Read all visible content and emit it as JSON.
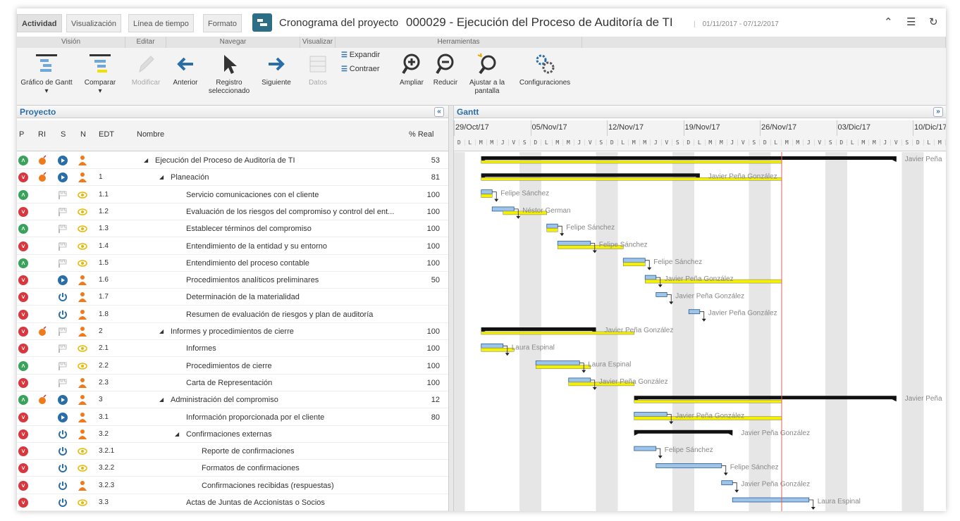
{
  "tabs": [
    "Actividad",
    "Visualización",
    "Línea de tiempo",
    "Formato"
  ],
  "breadcrumb": {
    "parent": "Cronograma del proyecto",
    "separator": "›",
    "current": "000029 - Ejecución del Proceso de Auditoría de TI"
  },
  "date_range": "01/11/2017 - 07/12/2017",
  "ribbon": {
    "groups": [
      "Visión",
      "Editar",
      "Navegar",
      "Visualizar",
      "Herramientas"
    ],
    "buttons": {
      "gantt": "Gráfico de Gantt",
      "compare": "Comparar",
      "modify": "Modificar",
      "previous": "Anterior",
      "selected_1": "Registro",
      "selected_2": "seleccionado",
      "next": "Siguiente",
      "data": "Datos",
      "expand": "Expandir",
      "collapse": "Contraer",
      "zoom_in": "Ampliar",
      "zoom_out": "Reducir",
      "fit_1": "Ajustar a la",
      "fit_2": "pantalla",
      "settings": "Configuraciones"
    }
  },
  "panels": {
    "project": "Proyecto",
    "gantt": "Gantt"
  },
  "columns": {
    "p": "P",
    "ri": "RI",
    "s": "S",
    "n": "N",
    "edt": "EDT",
    "name": "Nombre",
    "pct": "% Real"
  },
  "rows": [
    {
      "p": "green",
      "ri": true,
      "s": "run",
      "n": "user",
      "edt": "",
      "name": "Ejecución del Proceso de Auditoría de TI",
      "level": 0,
      "summary": true,
      "pct": "53"
    },
    {
      "p": "red",
      "ri": true,
      "s": "run",
      "n": "user",
      "edt": "1",
      "name": "Planeación",
      "level": 1,
      "summary": true,
      "pct": "81"
    },
    {
      "p": "green",
      "ri": false,
      "s": "flag",
      "n": "eye",
      "edt": "1.1",
      "name": "Servicio comunicaciones con el cliente",
      "level": 2,
      "summary": false,
      "pct": "100"
    },
    {
      "p": "red",
      "ri": false,
      "s": "flag",
      "n": "eye",
      "edt": "1.2",
      "name": "Evaluación de los riesgos del compromiso y control del ent...",
      "level": 2,
      "summary": false,
      "pct": "100"
    },
    {
      "p": "green",
      "ri": false,
      "s": "flag",
      "n": "eye",
      "edt": "1.3",
      "name": "Establecer términos del compromiso",
      "level": 2,
      "summary": false,
      "pct": "100"
    },
    {
      "p": "red",
      "ri": false,
      "s": "flag",
      "n": "eye",
      "edt": "1.4",
      "name": "Entendimiento de la entidad y su entorno",
      "level": 2,
      "summary": false,
      "pct": "100"
    },
    {
      "p": "green",
      "ri": false,
      "s": "flag",
      "n": "eye",
      "edt": "1.5",
      "name": "Entendimiento del proceso contable",
      "level": 2,
      "summary": false,
      "pct": "100"
    },
    {
      "p": "red",
      "ri": false,
      "s": "run",
      "n": "user",
      "edt": "1.6",
      "name": "Procedimientos analíticos preliminares",
      "level": 2,
      "summary": false,
      "pct": "50"
    },
    {
      "p": "red",
      "ri": false,
      "s": "power",
      "n": "user",
      "edt": "1.7",
      "name": "Determinación de la materialidad",
      "level": 2,
      "summary": false,
      "pct": ""
    },
    {
      "p": "red",
      "ri": false,
      "s": "power",
      "n": "user",
      "edt": "1.8",
      "name": "Resumen de evaluación de riesgos y plan de auditoría",
      "level": 2,
      "summary": false,
      "pct": ""
    },
    {
      "p": "red",
      "ri": true,
      "s": "flag",
      "n": "user",
      "edt": "2",
      "name": "Informes y procedimientos de cierre",
      "level": 1,
      "summary": true,
      "pct": "100"
    },
    {
      "p": "red",
      "ri": false,
      "s": "flag",
      "n": "eye",
      "edt": "2.1",
      "name": "Informes",
      "level": 2,
      "summary": false,
      "pct": "100"
    },
    {
      "p": "green",
      "ri": false,
      "s": "flag",
      "n": "eye",
      "edt": "2.2",
      "name": "Procedimientos de cierre",
      "level": 2,
      "summary": false,
      "pct": "100"
    },
    {
      "p": "red",
      "ri": false,
      "s": "flag",
      "n": "user",
      "edt": "2.3",
      "name": "Carta de Representación",
      "level": 2,
      "summary": false,
      "pct": "100"
    },
    {
      "p": "green",
      "ri": true,
      "s": "run",
      "n": "user",
      "edt": "3",
      "name": "Administración del compromiso",
      "level": 1,
      "summary": true,
      "pct": "12"
    },
    {
      "p": "red",
      "ri": false,
      "s": "run",
      "n": "user",
      "edt": "3.1",
      "name": "Información proporcionada por el cliente",
      "level": 2,
      "summary": false,
      "pct": "80"
    },
    {
      "p": "red",
      "ri": false,
      "s": "power",
      "n": "user",
      "edt": "3.2",
      "name": "Confirmaciones externas",
      "level": 2,
      "summary": true,
      "pct": ""
    },
    {
      "p": "red",
      "ri": false,
      "s": "power",
      "n": "eye",
      "edt": "3.2.1",
      "name": "Reporte de confirmaciones",
      "level": 3,
      "summary": false,
      "pct": ""
    },
    {
      "p": "red",
      "ri": false,
      "s": "power",
      "n": "eye",
      "edt": "3.2.2",
      "name": "Formatos de confirmaciones",
      "level": 3,
      "summary": false,
      "pct": ""
    },
    {
      "p": "red",
      "ri": false,
      "s": "power",
      "n": "user",
      "edt": "3.2.3",
      "name": "Confirmaciones recibidas (respuestas)",
      "level": 3,
      "summary": false,
      "pct": ""
    },
    {
      "p": "red",
      "ri": false,
      "s": "power",
      "n": "eye",
      "edt": "3.3",
      "name": "Actas de Juntas de Accionistas o Socios",
      "level": 2,
      "summary": false,
      "pct": ""
    }
  ],
  "gantt": {
    "weeks": [
      "29/Oct/17",
      "05/Nov/17",
      "12/Nov/17",
      "19/Nov/17",
      "26/Nov/17",
      "03/Dic/17",
      "10/Dic/17"
    ],
    "day_letters": [
      "D",
      "L",
      "M",
      "M",
      "J",
      "V",
      "S"
    ],
    "bars": [
      {
        "type": "summary",
        "start": 2.5,
        "end": 40.5,
        "yellow_end": 30,
        "label": "Javier Peña",
        "label_at": 40.5
      },
      {
        "type": "summary",
        "start": 2.5,
        "end": 22.5,
        "yellow_end": 30,
        "label": "Javier Peña González",
        "label_at": 22.5
      },
      {
        "type": "task",
        "start": 2.5,
        "end": 3.5,
        "yellow_start": 2.5,
        "yellow_end": 3.5,
        "label": "Felipe Sánchez"
      },
      {
        "type": "task",
        "start": 3.5,
        "end": 5.5,
        "yellow_start": 4.5,
        "yellow_end": 8.5,
        "label": "Néstor German"
      },
      {
        "type": "task",
        "start": 8.5,
        "end": 9.5,
        "yellow_start": 8.5,
        "yellow_end": 9.5,
        "label": "Felipe Sánchez"
      },
      {
        "type": "task",
        "start": 9.5,
        "end": 12.5,
        "yellow_start": 9.5,
        "yellow_end": 15.5,
        "label": "Felipe Sánchez"
      },
      {
        "type": "task",
        "start": 15.5,
        "end": 17.5,
        "yellow_start": 15.5,
        "yellow_end": 17.5,
        "label": "Felipe Sánchez"
      },
      {
        "type": "task",
        "start": 17.5,
        "end": 18.5,
        "yellow_start": 17.5,
        "yellow_end": 30,
        "label": "Javier Peña González"
      },
      {
        "type": "task",
        "start": 18.5,
        "end": 19.5,
        "label": "Javier Peña González"
      },
      {
        "type": "task",
        "start": 21.5,
        "end": 22.5,
        "label": "Javier Peña González"
      },
      {
        "type": "summary",
        "start": 2.5,
        "end": 13,
        "yellow_end": 16.5,
        "label": "Javier Peña González",
        "label_at": 13
      },
      {
        "type": "task",
        "start": 2.5,
        "end": 4.5,
        "yellow_start": 2.5,
        "yellow_end": 5.5,
        "label": "Laura Espinal"
      },
      {
        "type": "task",
        "start": 7.5,
        "end": 11.5,
        "yellow_start": 7.5,
        "yellow_end": 12.5,
        "label": "Laura Espinal"
      },
      {
        "type": "task",
        "start": 10.5,
        "end": 12.5,
        "yellow_start": 10.5,
        "yellow_end": 16.5,
        "label": "Javier Peña González"
      },
      {
        "type": "summary",
        "start": 16.5,
        "end": 40.5,
        "yellow_end": 30,
        "label": "Javier Peña",
        "label_at": 40.5
      },
      {
        "type": "task",
        "start": 16.5,
        "end": 19.5,
        "yellow_start": 16.5,
        "yellow_end": 30,
        "label": "Javier Peña González"
      },
      {
        "type": "summary",
        "start": 16.5,
        "end": 25.5,
        "label": "Javier Peña González"
      },
      {
        "type": "task",
        "start": 16.5,
        "end": 18.5,
        "label": "Felipe Sánchez"
      },
      {
        "type": "task",
        "start": 18.5,
        "end": 24.5,
        "label": "Felipe Sánchez"
      },
      {
        "type": "task",
        "start": 24.5,
        "end": 25.5,
        "label": "Javier Peña González"
      },
      {
        "type": "task",
        "start": 25.5,
        "end": 32.5,
        "label": "Laura Espinal"
      }
    ],
    "today_day": 30,
    "colors": {
      "task": "#9fc4ea",
      "task_border": "#2a5c8f",
      "actual": "#f4f000",
      "summary": "#111111",
      "today": "#e06060",
      "weekend": "#e6e6e6"
    }
  }
}
